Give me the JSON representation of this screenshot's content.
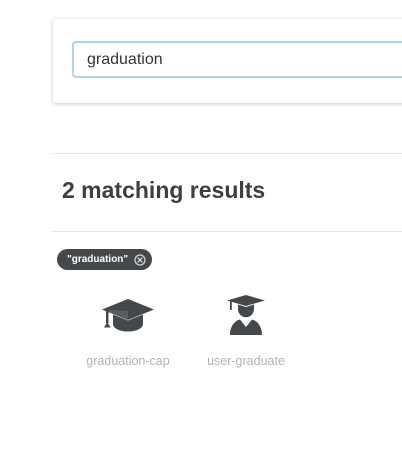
{
  "search": {
    "value": "graduation"
  },
  "results": {
    "heading": "2 matching results",
    "filter_chip_label": "\"graduation\"",
    "items": [
      {
        "name": "graduation-cap",
        "icon": "graduation-cap-icon"
      },
      {
        "name": "user-graduate",
        "icon": "user-graduate-icon"
      }
    ]
  },
  "colors": {
    "icon": "#45484b",
    "chip_background": "#45484b",
    "input_focus_border": "#a9d2f5",
    "label_muted": "#b3b3b3",
    "heading": "#3e3e3e"
  }
}
